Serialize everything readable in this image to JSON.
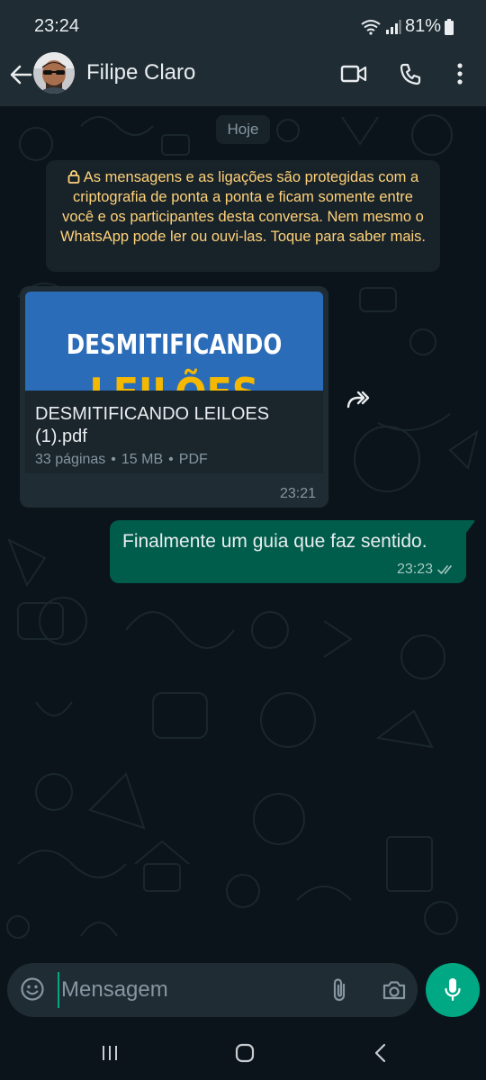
{
  "status_bar": {
    "time": "23:24",
    "battery": "81%"
  },
  "header": {
    "contact_name": "Filipe Claro",
    "icons": [
      "back-arrow-icon",
      "video-call-icon",
      "voice-call-icon",
      "more-options-icon"
    ]
  },
  "chat": {
    "date_chip": "Hoje",
    "encryption_notice": "As mensagens e as ligações são protegidas com a criptografia de ponta a ponta e ficam somente entre você e os participantes desta conversa. Nem mesmo o WhatsApp pode ler ou ouvi-las. Toque para saber mais.",
    "messages": [
      {
        "direction": "incoming",
        "type": "document",
        "thumbnail_title": "DESMITIFICANDO",
        "thumbnail_subtitle": "LEILÕES",
        "file_name": "DESMITIFICANDO LEILOES (1).pdf",
        "pages": "33 páginas",
        "size": "15 MB",
        "file_type": "PDF",
        "time": "23:21"
      },
      {
        "direction": "outgoing",
        "type": "text",
        "text": "Finalmente um guia que faz sentido.",
        "time": "23:23",
        "status": "read"
      }
    ]
  },
  "composer": {
    "placeholder": "Mensagem"
  },
  "colors": {
    "background": "#0b141a",
    "header": "#1f2c34",
    "incoming_bubble": "#202c33",
    "outgoing_bubble": "#005c4b",
    "accent": "#00a884",
    "notice_text": "#ffd279"
  }
}
